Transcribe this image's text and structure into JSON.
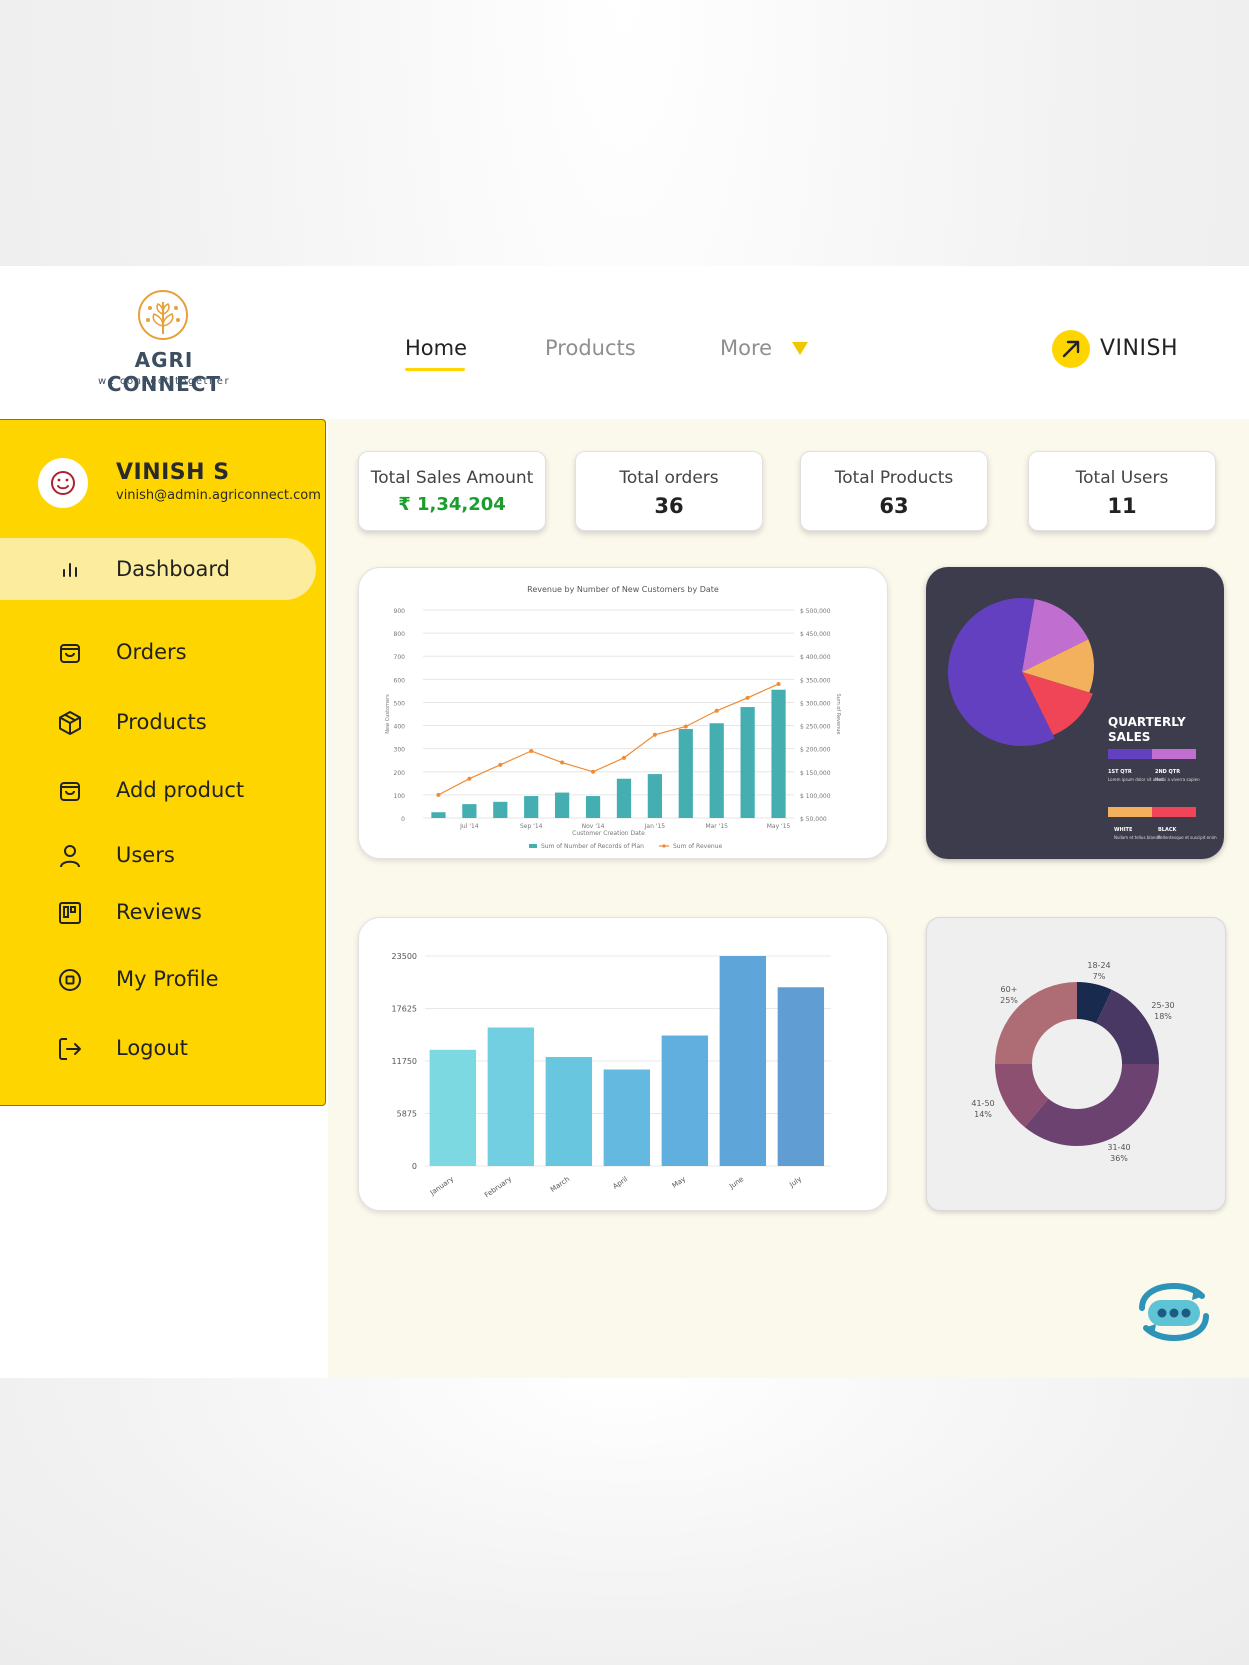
{
  "brand": {
    "name": "AGRI CONNECT",
    "tagline": "we connect together"
  },
  "nav": {
    "home": "Home",
    "products": "Products",
    "more": "More"
  },
  "header_user": {
    "name": "VINISH"
  },
  "profile": {
    "name": "VINISH S",
    "email": "vinish@admin.agriconnect.com"
  },
  "sidebar": {
    "items": [
      {
        "label": "Dashboard",
        "icon": "bar-chart-icon",
        "active": true
      },
      {
        "label": "Orders",
        "icon": "shopping-bag-icon"
      },
      {
        "label": "Products",
        "icon": "package-icon"
      },
      {
        "label": "Add product",
        "icon": "shopping-bag-icon"
      },
      {
        "label": "Users",
        "icon": "user-icon"
      },
      {
        "label": "Reviews",
        "icon": "board-icon"
      },
      {
        "label": "My Profile",
        "icon": "profile-circle-icon"
      },
      {
        "label": "Logout",
        "icon": "logout-icon"
      }
    ]
  },
  "stats": [
    {
      "title": "Total Sales Amount",
      "value": "₹ 1,34,204"
    },
    {
      "title": "Total orders",
      "value": "36"
    },
    {
      "title": "Total Products",
      "value": "63"
    },
    {
      "title": "Total Users",
      "value": "11"
    }
  ],
  "colors": {
    "accent": "#ffd500",
    "sidebar_active": "#fcec9e",
    "main_bg": "#fbf8ec",
    "sales_green": "#1a9e2d"
  },
  "chart_data": [
    {
      "type": "bar",
      "title": "Revenue by Number of New Customers by Date",
      "xlabel": "Customer Creation Date",
      "ylabel": "New Customers",
      "y2label": "Sum of Revenue",
      "ylim": [
        0,
        900
      ],
      "y_ticks": [
        "0",
        "100",
        "200",
        "300",
        "400",
        "500",
        "600",
        "700",
        "800",
        "900"
      ],
      "y2_ticks": [
        "$ 50,000",
        "$ 100,000",
        "$ 150,000",
        "$ 200,000",
        "$ 250,000",
        "$ 300,000",
        "$ 350,000",
        "$ 400,000",
        "$ 450,000",
        "$ 500,000"
      ],
      "x_tick_labels": [
        "Jul '14",
        "Sep '14",
        "Nov '14",
        "Jan '15",
        "Mar '15",
        "May '15"
      ],
      "series": [
        {
          "name": "Sum of Number of Records of Plan",
          "type": "bar",
          "color": "#45aeb1",
          "values": [
            25,
            60,
            70,
            95,
            110,
            95,
            170,
            190,
            385,
            410,
            480,
            555
          ]
        },
        {
          "name": "Sum of Revenue",
          "type": "line",
          "color": "#f08a33",
          "values": [
            100000,
            135000,
            165000,
            195000,
            170000,
            150000,
            180000,
            230000,
            248000,
            282000,
            310000,
            340000
          ]
        }
      ],
      "grid": true,
      "legend": "bottom"
    },
    {
      "type": "pie",
      "title": "QUARTERLY SALES",
      "slices": [
        {
          "label": "1ST QTR",
          "value": 60,
          "color": "#6340c0"
        },
        {
          "label": "2ND QTR",
          "value": 15,
          "color": "#c06fd1"
        },
        {
          "label": "WHITE",
          "value": 12,
          "color": "#f3b15e"
        },
        {
          "label": "BLACK",
          "value": 13,
          "color": "#f04457"
        }
      ],
      "legend_notes": [
        "Lorem ipsum dolor sit amet",
        "Morbi a viverra sapien",
        "Nullam et tellus blandit",
        "Pellentesque et suscipit enim"
      ]
    },
    {
      "type": "bar",
      "categories": [
        "January",
        "February",
        "March",
        "April",
        "May",
        "June",
        "July"
      ],
      "values": [
        13000,
        15500,
        12200,
        10800,
        14600,
        23500,
        20000
      ],
      "ylim": [
        0,
        23500
      ],
      "y_ticks": [
        "0",
        "5875",
        "11750",
        "17625",
        "23500"
      ],
      "colors": [
        "#7cd8e1",
        "#72cfe1",
        "#69c6df",
        "#63b9df",
        "#60afdf",
        "#5ea5da",
        "#609dd2"
      ],
      "grid": true
    },
    {
      "type": "pie",
      "donut": true,
      "slices": [
        {
          "label": "18-24",
          "value": 7,
          "pct": "7%",
          "color": "#182a4e"
        },
        {
          "label": "25-30",
          "value": 18,
          "pct": "18%",
          "color": "#483863"
        },
        {
          "label": "31-40",
          "value": 36,
          "pct": "36%",
          "color": "#6c4370"
        },
        {
          "label": "41-50",
          "value": 14,
          "pct": "14%",
          "color": "#8d5070"
        },
        {
          "label": "60+",
          "value": 25,
          "pct": "25%",
          "color": "#ae6c75"
        }
      ]
    }
  ]
}
